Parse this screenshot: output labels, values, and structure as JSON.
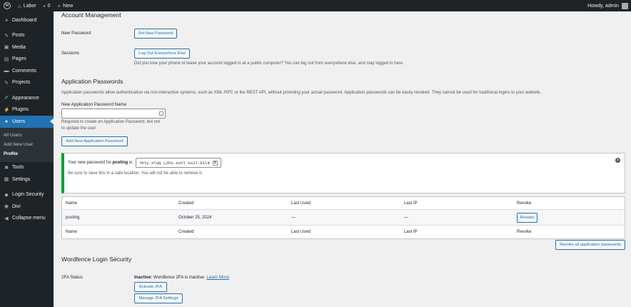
{
  "adminbar": {
    "site_name": "Labor",
    "comments_count": "0",
    "new_label": "New",
    "howdy": "Howdy, admin"
  },
  "sidebar": {
    "items": [
      {
        "label": "Dashboard",
        "icon": "dashboard-icon"
      },
      {
        "label": "Posts",
        "icon": "pin-icon"
      },
      {
        "label": "Media",
        "icon": "media-icon"
      },
      {
        "label": "Pages",
        "icon": "page-icon"
      },
      {
        "label": "Comments",
        "icon": "comment-icon"
      },
      {
        "label": "Projects",
        "icon": "pin-icon"
      },
      {
        "label": "Appearance",
        "icon": "brush-icon"
      },
      {
        "label": "Plugins",
        "icon": "plug-icon"
      },
      {
        "label": "Users",
        "icon": "user-icon"
      },
      {
        "label": "Tools",
        "icon": "wrench-icon"
      },
      {
        "label": "Settings",
        "icon": "settings-icon"
      },
      {
        "label": "Login Security",
        "icon": "shield-icon"
      },
      {
        "label": "Divi",
        "icon": "divi-icon"
      },
      {
        "label": "Collapse menu",
        "icon": "collapse-icon"
      }
    ],
    "users_submenu": [
      "All Users",
      "Add New User",
      "Profile"
    ]
  },
  "account": {
    "title": "Account Management",
    "new_password_label": "New Password",
    "set_new_password_button": "Set New Password",
    "sessions_label": "Sessions",
    "logout_button": "Log Out Everywhere Else",
    "sessions_desc": "Did you lose your phone or leave your account logged in at a public computer? You can log out from everywhere else, and stay logged in here."
  },
  "app_passwords": {
    "title": "Application Passwords",
    "desc": "Application passwords allow authentication via non-interactive systems, such as XML-RPC or the REST API, without providing your actual password. Application passwords can be easily revoked. They cannot be used for traditional logins to your website.",
    "new_name_label": "New Application Password Name",
    "name_input_value": "",
    "help_line1": "Required to create an Application Password, but not",
    "help_line2": "to update the user.",
    "add_button": "Add New Application Password",
    "notice_prefix": "Your new password for",
    "notice_name": "posting",
    "notice_suffix": "is:",
    "new_password": "7Kly xTuQ LZFU zoVl SuJl Dil4",
    "notice_warning": "Be sure to save this in a safe location. You will not be able to retrieve it.",
    "columns": [
      "Name",
      "Created",
      "Last Used",
      "Last IP",
      "Revoke"
    ],
    "rows": [
      {
        "name": "posting",
        "created": "October 25, 2024",
        "last_used": "—",
        "last_ip": "—",
        "revoke": "Revoke"
      }
    ],
    "revoke_all_button": "Revoke all application passwords"
  },
  "wordfence": {
    "title": "Wordfence Login Security",
    "status_label": "2FA Status",
    "inactive_label": "Inactive:",
    "inactive_text": "Wordfence 2FA is inactive.",
    "learn_more": "Learn More",
    "activate_button": "Activate 2FA",
    "manage_button": "Manage 2FA Settings"
  }
}
